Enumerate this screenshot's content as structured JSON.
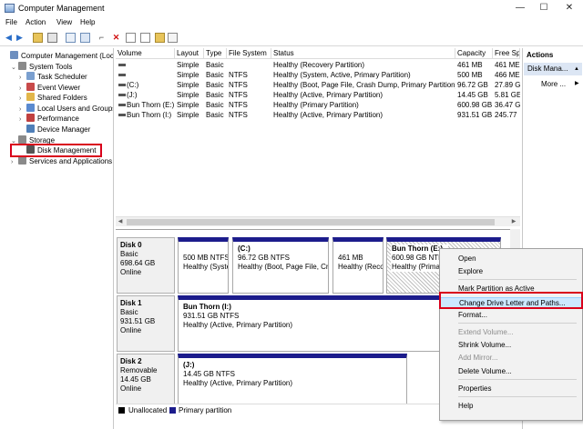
{
  "window": {
    "title": "Computer Management",
    "minimize": "—",
    "maximize": "☐",
    "close": "✕"
  },
  "menu": [
    "File",
    "Action",
    "View",
    "Help"
  ],
  "tree": [
    {
      "label": "Computer Management (Local",
      "indent": 0,
      "caret": "",
      "icon": "#6d8fbf"
    },
    {
      "label": "System Tools",
      "indent": 1,
      "caret": "v",
      "icon": "#8a8a8a"
    },
    {
      "label": "Task Scheduler",
      "indent": 2,
      "caret": ">",
      "icon": "#7a9fcf"
    },
    {
      "label": "Event Viewer",
      "indent": 2,
      "caret": ">",
      "icon": "#c84a4a"
    },
    {
      "label": "Shared Folders",
      "indent": 2,
      "caret": ">",
      "icon": "#e2b64a"
    },
    {
      "label": "Local Users and Groups",
      "indent": 2,
      "caret": ">",
      "icon": "#5a8ad0"
    },
    {
      "label": "Performance",
      "indent": 2,
      "caret": ">",
      "icon": "#c04040"
    },
    {
      "label": "Device Manager",
      "indent": 2,
      "caret": "",
      "icon": "#4f7fb8"
    },
    {
      "label": "Storage",
      "indent": 1,
      "caret": "v",
      "icon": "#8a8a8a"
    },
    {
      "label": "Disk Management",
      "indent": 2,
      "caret": "",
      "icon": "#555555"
    },
    {
      "label": "Services and Applications",
      "indent": 1,
      "caret": ">",
      "icon": "#8a8a8a"
    }
  ],
  "volume_table": {
    "columns": [
      "Volume",
      "Layout",
      "Type",
      "File System",
      "Status",
      "Capacity",
      "Free Sp"
    ],
    "rows": [
      [
        "",
        "Simple",
        "Basic",
        "",
        "Healthy (Recovery Partition)",
        "461 MB",
        "461 ME"
      ],
      [
        "",
        "Simple",
        "Basic",
        "NTFS",
        "Healthy (System, Active, Primary Partition)",
        "500 MB",
        "466 ME"
      ],
      [
        "(C:)",
        "Simple",
        "Basic",
        "NTFS",
        "Healthy (Boot, Page File, Crash Dump, Primary Partition)",
        "96.72 GB",
        "27.89 G"
      ],
      [
        "(J:)",
        "Simple",
        "Basic",
        "NTFS",
        "Healthy (Active, Primary Partition)",
        "14.45 GB",
        "5.81 GE"
      ],
      [
        "Bun Thorn (E:)",
        "Simple",
        "Basic",
        "NTFS",
        "Healthy (Primary Partition)",
        "600.98 GB",
        "36.47 G"
      ],
      [
        "Bun Thorn (I:)",
        "Simple",
        "Basic",
        "NTFS",
        "Healthy (Active, Primary Partition)",
        "931.51 GB",
        "245.77"
      ]
    ]
  },
  "disks": [
    {
      "name": "Disk 0",
      "type": "Basic",
      "size": "698.64 GB",
      "state": "Online",
      "partitions": [
        {
          "title": "",
          "line1": "500 MB NTFS",
          "line2": "Healthy (Syste"
        },
        {
          "title": "(C:)",
          "line1": "96.72 GB NTFS",
          "line2": "Healthy (Boot, Page File, Cra"
        },
        {
          "title": "",
          "line1": "461 MB",
          "line2": "Healthy (Reco"
        },
        {
          "title": "Bun Thorn  (E:)",
          "line1": "600.98 GB NTFS",
          "line2": "Healthy (Primar"
        }
      ]
    },
    {
      "name": "Disk 1",
      "type": "Basic",
      "size": "931.51 GB",
      "state": "Online",
      "partitions": [
        {
          "title": "Bun Thorn  (I:)",
          "line1": "931.51 GB NTFS",
          "line2": "Healthy (Active, Primary Partition)"
        }
      ]
    },
    {
      "name": "Disk 2",
      "type": "Removable",
      "size": "14.45 GB",
      "state": "Online",
      "partitions": [
        {
          "title": "(J:)",
          "line1": "14.45 GB NTFS",
          "line2": "Healthy (Active, Primary Partition)"
        }
      ]
    }
  ],
  "legend": {
    "unallocated": "Unallocated",
    "primary": "Primary partition",
    "unallocated_color": "#000000",
    "primary_color": "#1c1c8c"
  },
  "actions": {
    "title": "Actions",
    "item": "Disk Mana...",
    "more": "More ..."
  },
  "context_menu": [
    {
      "label": "Open",
      "enabled": true
    },
    {
      "label": "Explore",
      "enabled": true
    },
    {
      "label": "Mark Partition as Active",
      "enabled": true
    },
    {
      "label": "Change Drive Letter and Paths...",
      "enabled": true
    },
    {
      "label": "Format...",
      "enabled": true
    },
    {
      "label": "Extend Volume...",
      "enabled": false
    },
    {
      "label": "Shrink Volume...",
      "enabled": true
    },
    {
      "label": "Add Mirror...",
      "enabled": false
    },
    {
      "label": "Delete Volume...",
      "enabled": true
    },
    {
      "label": "Properties",
      "enabled": true
    },
    {
      "label": "Help",
      "enabled": true
    }
  ],
  "colors": {
    "accent": "#1c1c8c",
    "highlight": "#d9001b"
  }
}
